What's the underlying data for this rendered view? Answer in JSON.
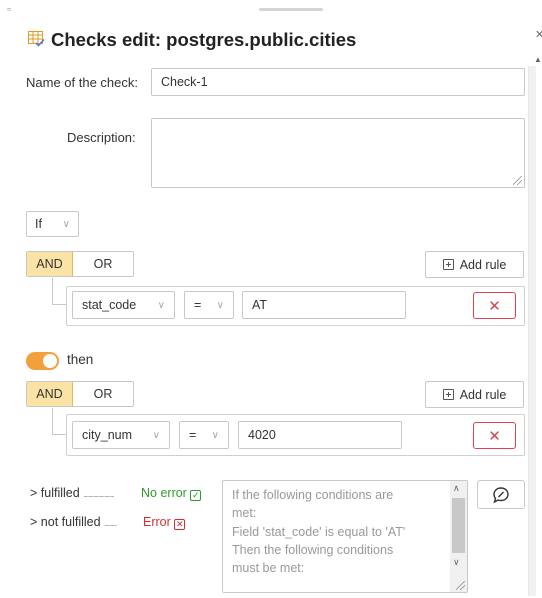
{
  "window": {
    "title": "Checks edit: postgres.public.cities"
  },
  "form": {
    "name_label": "Name of the check:",
    "name_value": "Check-1",
    "description_label": "Description:",
    "description_value": ""
  },
  "if_select": {
    "value": "If"
  },
  "if_block": {
    "and_label": "AND",
    "or_label": "OR",
    "active": "AND",
    "add_rule_label": "Add rule",
    "rule": {
      "field": "stat_code",
      "operator": "=",
      "value": "AT"
    }
  },
  "then_toggle": {
    "on": true,
    "label": "then"
  },
  "then_block": {
    "and_label": "AND",
    "or_label": "OR",
    "active": "AND",
    "add_rule_label": "Add rule",
    "rule": {
      "field": "city_num",
      "operator": "=",
      "value": "4020"
    }
  },
  "results": {
    "fulfilled_label": "fulfilled",
    "fulfilled_status": "No error",
    "not_fulfilled_label": "not fulfilled",
    "not_fulfilled_status": "Error",
    "message_lines": [
      "If the following conditions are",
      "met:",
      "Field 'stat_code' is equal to 'AT'",
      "Then the following conditions",
      "must be met:"
    ]
  },
  "icons": {
    "title": "table-check-icon",
    "fulfilled_status": "check-square-icon",
    "not_fulfilled_status": "x-square-icon",
    "delete": "close-icon",
    "add": "plus-square-icon",
    "comment": "speech-bubble-icon",
    "chevron": "chevron-down-icon",
    "expand": "chevron-right-icon"
  },
  "colors": {
    "active_segment": "#fbe3a6",
    "toggle_on": "#f2a03d",
    "ok": "#2e9a2e",
    "error": "#d32f2f",
    "delete_border": "#d9464f"
  }
}
